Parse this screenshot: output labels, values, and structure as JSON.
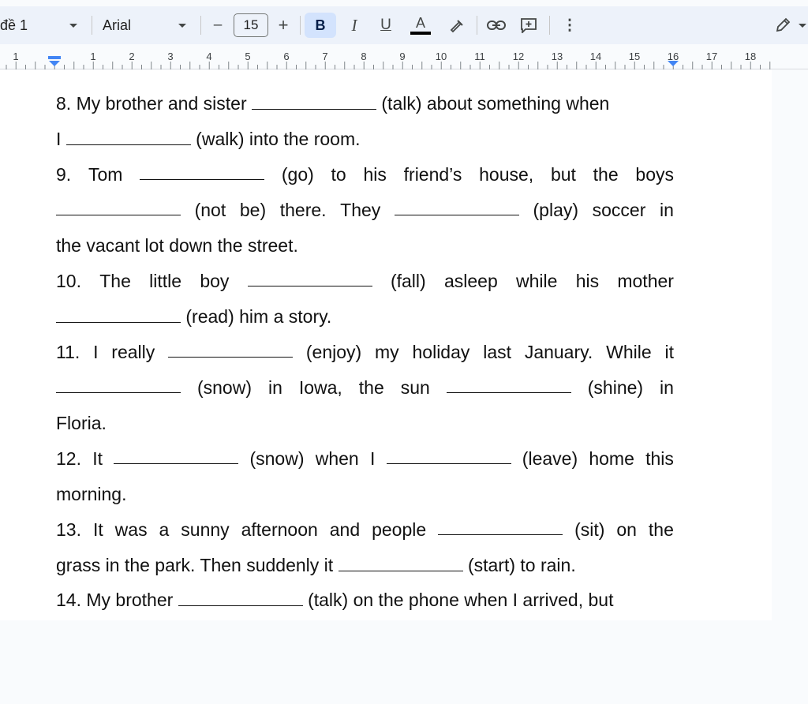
{
  "toolbar": {
    "style_label": "đề 1",
    "font_name": "Arial",
    "font_size": "15",
    "minus": "–",
    "plus": "+",
    "bold": "B",
    "italic": "I",
    "underline": "U",
    "text_color": "A",
    "more": "⋮",
    "icons": [
      "pencil-icon",
      "link-icon",
      "add-comment-icon",
      "highlighter-icon"
    ]
  },
  "ruler": {
    "numbers": [
      "1",
      "1",
      "2",
      "3",
      "4",
      "5",
      "6",
      "7",
      "8",
      "9",
      "10",
      "11",
      "12",
      "13",
      "14",
      "15",
      "16",
      "17",
      "18"
    ]
  },
  "document": {
    "lines": [
      [
        "8. My brother and sister",
        "BLANK",
        "(talk) about something when"
      ],
      [
        "I",
        "BLANK",
        "(walk) into the room."
      ],
      [
        "9.",
        "Tom",
        "BLANK",
        "(go)",
        "to",
        "his",
        "friend’s",
        "house,",
        "but",
        "the",
        "boys"
      ],
      [
        "BLANK",
        "(not",
        "be)",
        "there.",
        "They",
        "BLANK",
        "(play)",
        "soccer",
        "in"
      ],
      [
        "the vacant lot down the street."
      ],
      [
        "10.",
        "The",
        "little",
        "boy",
        "BLANK",
        "(fall)",
        "asleep",
        "while",
        "his",
        "mother"
      ],
      [
        "BLANK",
        "(read) him a story."
      ],
      [
        "11.",
        "I",
        "really",
        "BLANK",
        "(enjoy)",
        "my",
        "holiday",
        "last",
        "January.",
        "While",
        "it"
      ],
      [
        "BLANK",
        "(snow)",
        "in",
        "Iowa,",
        "the",
        "sun",
        "BLANK",
        "(shine)",
        "in"
      ],
      [
        "Floria."
      ],
      [
        "12.",
        "It",
        "BLANK",
        "(snow)",
        "when",
        "I",
        "BLANK",
        "(leave)",
        "home",
        "this"
      ],
      [
        "morning."
      ],
      [
        "13.",
        "It",
        "was",
        "a",
        "sunny",
        "afternoon",
        "and",
        "people",
        "BLANK",
        "(sit)",
        "on",
        "the"
      ],
      [
        "grass in the park. Then suddenly it",
        "BLANK",
        "(start) to rain."
      ],
      [
        "14. My brother",
        "BLANK",
        "(talk) on the phone when I arrived, but"
      ]
    ]
  }
}
